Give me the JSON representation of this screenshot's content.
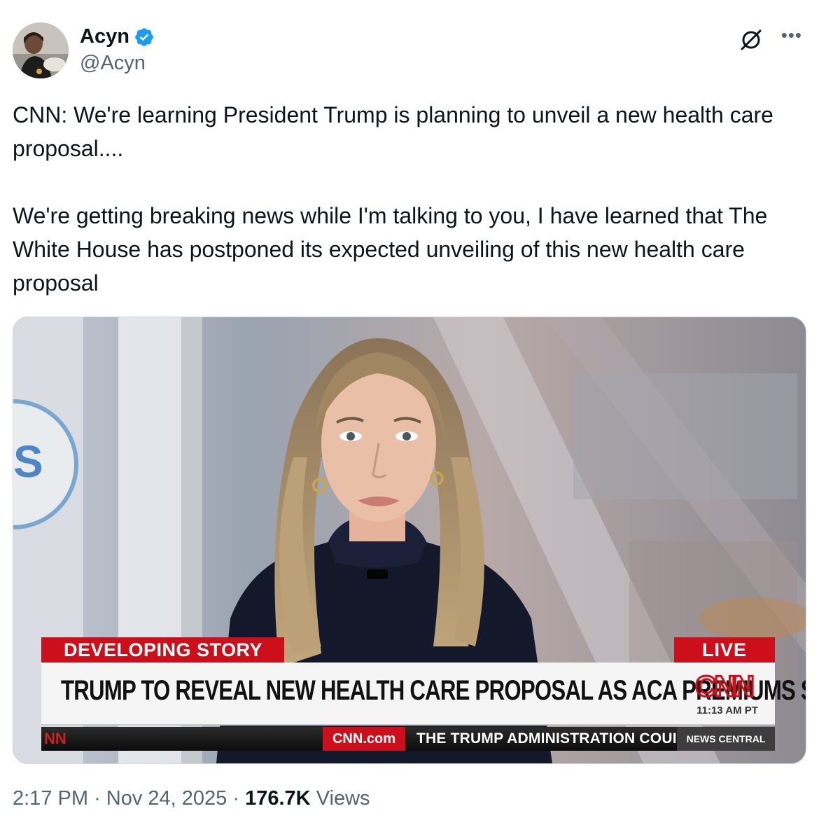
{
  "author": {
    "name": "Acyn",
    "handle": "@Acyn"
  },
  "tweet": {
    "paragraph_1": "CNN: We're learning President Trump is planning to unveil a new health care proposal....",
    "paragraph_2": "We're getting breaking news while I'm talking to you, I have learned that The White House has postponed its expected unveiling of this new health care proposal"
  },
  "media": {
    "developing_label": "DEVELOPING STORY",
    "live_label": "LIVE",
    "headline": "TRUMP TO REVEAL NEW HEALTH CARE PROPOSAL AS ACA PREMIUMS SET TO SOAR",
    "logo_text": "CNN",
    "time": "11:13 AM PT",
    "ticker_left": "NN",
    "cnn_com": "CNN.com",
    "ticker_text": "THE TRUMP ADMINISTRATION COUI",
    "network_label": "NEWS CENTRAL",
    "bg_text": "S AL"
  },
  "meta": {
    "time": "2:17 PM",
    "separator": "·",
    "date": "Nov 24, 2025",
    "views_count": "176.7K",
    "views_label": "Views"
  },
  "colors": {
    "verified_blue": "#1d9bf0",
    "cnn_red": "#cc0f1b",
    "muted_text": "#536471"
  },
  "icons": [
    "verified-badge-icon",
    "grok-icon",
    "more-icon"
  ]
}
